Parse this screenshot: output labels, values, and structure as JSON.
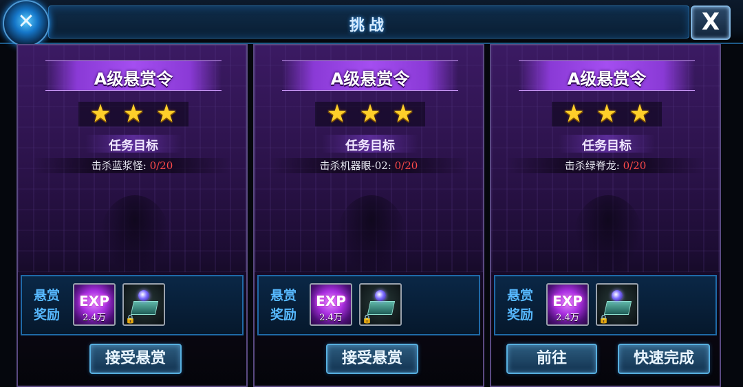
{
  "window": {
    "title": "挑战",
    "close_label": "X"
  },
  "cards": [
    {
      "banner": "A级悬赏令",
      "stars": 3,
      "goal_title": "任务目标",
      "task_text": "击杀蓝浆怪: ",
      "task_progress": "0/20",
      "reward_label": "悬赏奖励",
      "exp_badge": "EXP",
      "exp_amount": "2.4万",
      "buttons": [
        "接受悬赏"
      ]
    },
    {
      "banner": "A级悬赏令",
      "stars": 3,
      "goal_title": "任务目标",
      "task_text": "击杀机器眼-02: ",
      "task_progress": "0/20",
      "reward_label": "悬赏奖励",
      "exp_badge": "EXP",
      "exp_amount": "2.4万",
      "buttons": [
        "接受悬赏"
      ]
    },
    {
      "banner": "A级悬赏令",
      "stars": 3,
      "goal_title": "任务目标",
      "task_text": "击杀绿脊龙: ",
      "task_progress": "0/20",
      "reward_label": "悬赏奖励",
      "exp_badge": "EXP",
      "exp_amount": "2.4万",
      "buttons": [
        "前往",
        "快速完成"
      ]
    }
  ],
  "icons": {
    "emblem": "crossed-swords-emblem-icon",
    "star": "star-icon",
    "exp": "exp-icon",
    "chest": "treasure-chest-icon",
    "lock": "lock-icon"
  },
  "colors": {
    "accent_blue": "#58b0e0",
    "banner_purple": "#a44ef0",
    "progress_red": "#ff4a4a",
    "reward_label_blue": "#57b9ff",
    "star_gold": "#ffcf2a"
  }
}
